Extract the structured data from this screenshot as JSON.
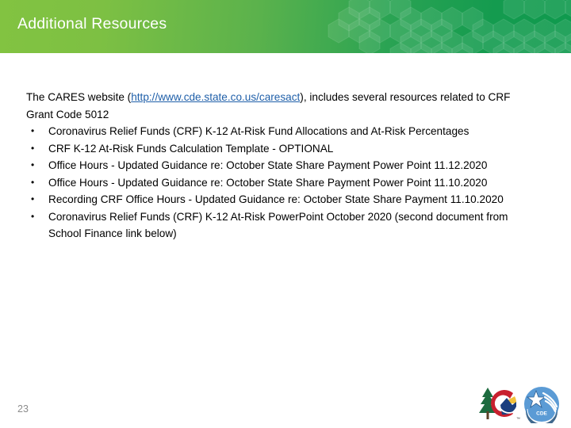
{
  "header": {
    "title": "Additional Resources",
    "gradient_from": "#82c341",
    "gradient_to": "#0f9a4e",
    "hex_pattern_icon": "hexagon-pattern-decoration"
  },
  "content": {
    "intro": {
      "before_link": "The CARES website (",
      "link_text": "http://www.cde.state.co.us/caresact",
      "after_link": "), includes several resources related to CRF Grant Code 5012"
    },
    "bullet_glyph": "•",
    "bullets": [
      "Coronavirus Relief Funds (CRF) K-12 At-Risk Fund Allocations and At-Risk Percentages",
      "CRF K-12 At-Risk Funds Calculation Template - OPTIONAL",
      "Office Hours - Updated Guidance re: October State Share Payment Power Point 11.12.2020",
      "Office Hours - Updated Guidance re: October State Share Payment Power Point 11.10.2020",
      "Recording CRF Office Hours - Updated Guidance re: October State Share Payment 11.10.2020",
      "Coronavirus Relief Funds (CRF) K-12 At-Risk PowerPoint October 2020 (second document from School Finance link below)"
    ]
  },
  "footer": {
    "slide_number": "23",
    "logos": [
      {
        "name": "colorado-state-logo",
        "label": "Colorado"
      },
      {
        "name": "cde-logo",
        "label": "CDE"
      }
    ]
  },
  "colors": {
    "link": "#1f5fa9",
    "text": "#000000",
    "slide_number": "#8c8c8c",
    "banner_left": "#82c341",
    "banner_right": "#0f9a4e"
  }
}
